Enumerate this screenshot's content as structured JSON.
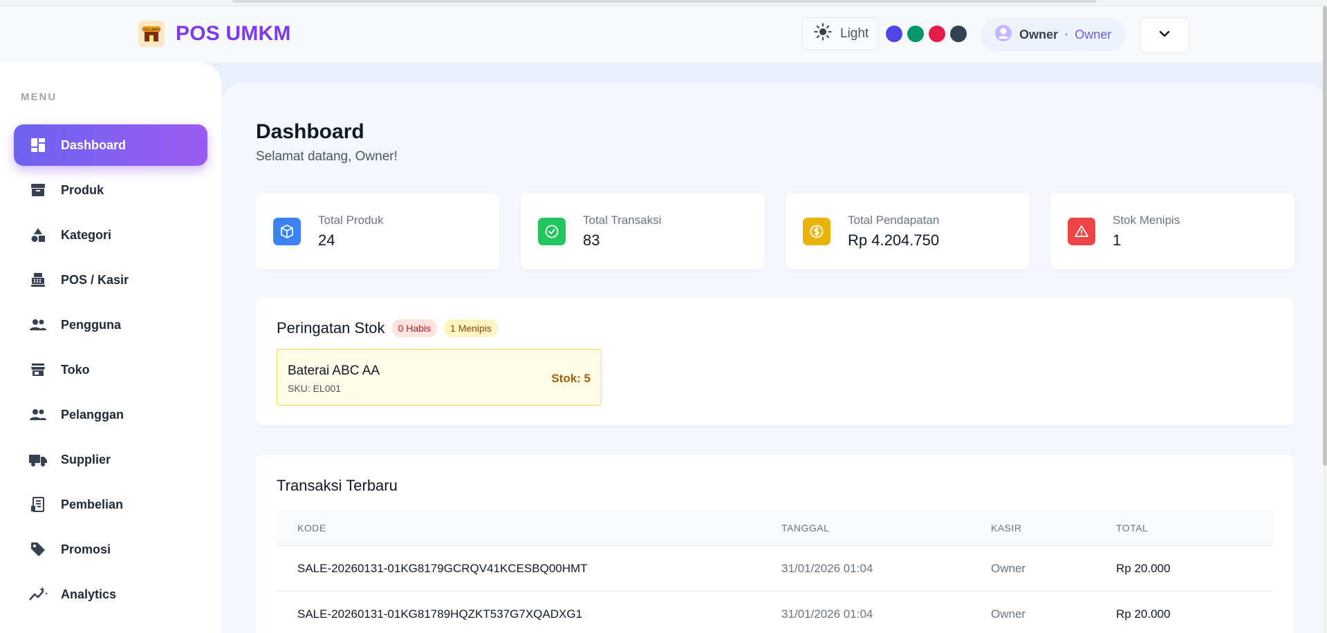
{
  "app": {
    "title": "POS UMKM",
    "logo_icon": "store-logo-icon",
    "logo_text": "POS UMKM"
  },
  "header": {
    "theme_label": "Light",
    "theme_icon": "sun-icon",
    "color_swatches": [
      "#4f46e5",
      "#059669",
      "#e11d48",
      "#334155"
    ],
    "user_name": "Owner",
    "user_role": "Owner",
    "dropdown_icon": "chevron-down-icon"
  },
  "sidebar": {
    "heading": "MENU",
    "items": [
      {
        "label": "Dashboard",
        "icon": "dashboard-icon",
        "active": true
      },
      {
        "label": "Produk",
        "icon": "archive-box-icon"
      },
      {
        "label": "Kategori",
        "icon": "shapes-icon"
      },
      {
        "label": "POS / Kasir",
        "icon": "cash-register-icon"
      },
      {
        "label": "Pengguna",
        "icon": "users-icon"
      },
      {
        "label": "Toko",
        "icon": "store-icon"
      },
      {
        "label": "Pelanggan",
        "icon": "users-icon"
      },
      {
        "label": "Supplier",
        "icon": "truck-icon"
      },
      {
        "label": "Pembelian",
        "icon": "receipt-icon"
      },
      {
        "label": "Promosi",
        "icon": "tag-icon"
      },
      {
        "label": "Analytics",
        "icon": "sparkline-icon"
      }
    ]
  },
  "main": {
    "title": "Dashboard",
    "subtitle": "Selamat datang, Owner!",
    "stats": [
      {
        "label": "Total Produk",
        "value": "24",
        "icon": "cube-icon",
        "color": "#3b82f6"
      },
      {
        "label": "Total Transaksi",
        "value": "83",
        "icon": "check-circle-icon",
        "color": "#22c55e"
      },
      {
        "label": "Total Pendapatan",
        "value": "Rp 4.204.750",
        "icon": "dollar-coin-icon",
        "color": "#eab308"
      },
      {
        "label": "Stok Menipis",
        "value": "1",
        "icon": "warning-triangle-icon",
        "color": "#ef4444"
      }
    ],
    "stock_warning": {
      "title": "Peringatan Stok",
      "badge_out": "0 Habis",
      "badge_low": "1 Menipis",
      "items": [
        {
          "name": "Baterai ABC AA",
          "sku": "SKU: EL001",
          "stock": "Stok: 5"
        }
      ]
    },
    "transactions": {
      "title": "Transaksi Terbaru",
      "columns": [
        "KODE",
        "TANGGAL",
        "KASIR",
        "TOTAL"
      ],
      "rows": [
        {
          "code": "SALE-20260131-01KG8179GCRQV41KCESBQ00HMT",
          "date": "31/01/2026 01:04",
          "cashier": "Owner",
          "total": "Rp 20.000"
        },
        {
          "code": "SALE-20260131-01KG81789HQZKT537G7XQADXG1",
          "date": "31/01/2026 01:04",
          "cashier": "Owner",
          "total": "Rp 20.000"
        }
      ]
    }
  }
}
